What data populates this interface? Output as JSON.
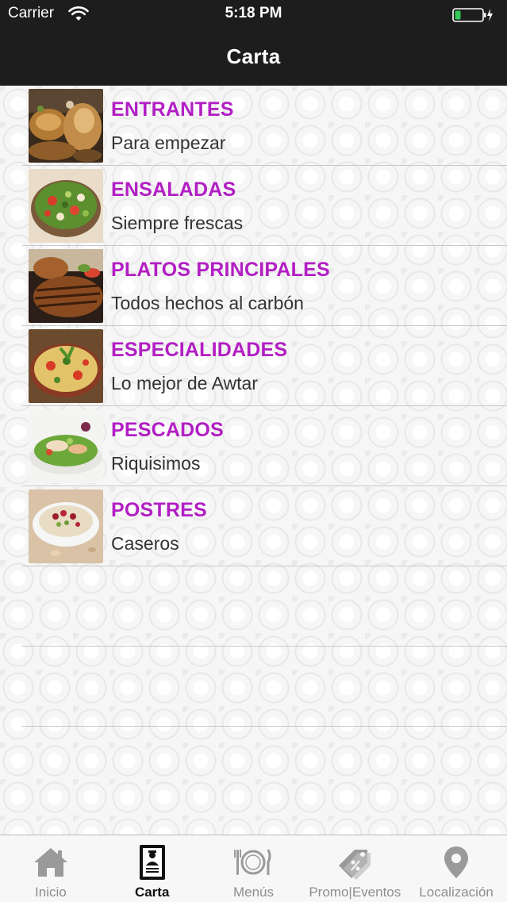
{
  "status_bar": {
    "carrier": "Carrier",
    "time": "5:18 PM",
    "battery_color": "#34c759"
  },
  "nav": {
    "title": "Carta"
  },
  "theme": {
    "accent": "#b21ec4",
    "bar_background": "#1d1d1d"
  },
  "menu": {
    "items": [
      {
        "title": "ENTRANTES",
        "subtitle": "Para empezar",
        "image": "entrantes-photo"
      },
      {
        "title": "ENSALADAS",
        "subtitle": "Siempre frescas",
        "image": "ensaladas-photo"
      },
      {
        "title": "PLATOS PRINCIPALES",
        "subtitle": "Todos hechos al carbón",
        "image": "platos-principales-photo"
      },
      {
        "title": "ESPECIALIDADES",
        "subtitle": "Lo mejor de Awtar",
        "image": "especialidades-photo"
      },
      {
        "title": "PESCADOS",
        "subtitle": "Riquisimos",
        "image": "pescados-photo"
      },
      {
        "title": "POSTRES",
        "subtitle": "Caseros",
        "image": "postres-photo"
      }
    ]
  },
  "tabs": [
    {
      "label": "Inicio",
      "icon": "home-icon",
      "active": false
    },
    {
      "label": "Carta",
      "icon": "menu-card-icon",
      "active": true
    },
    {
      "label": "Menús",
      "icon": "plate-cutlery-icon",
      "active": false
    },
    {
      "label": "Promo|Eventos",
      "icon": "discount-tag-icon",
      "active": false
    },
    {
      "label": "Localización",
      "icon": "location-pin-icon",
      "active": false
    }
  ]
}
